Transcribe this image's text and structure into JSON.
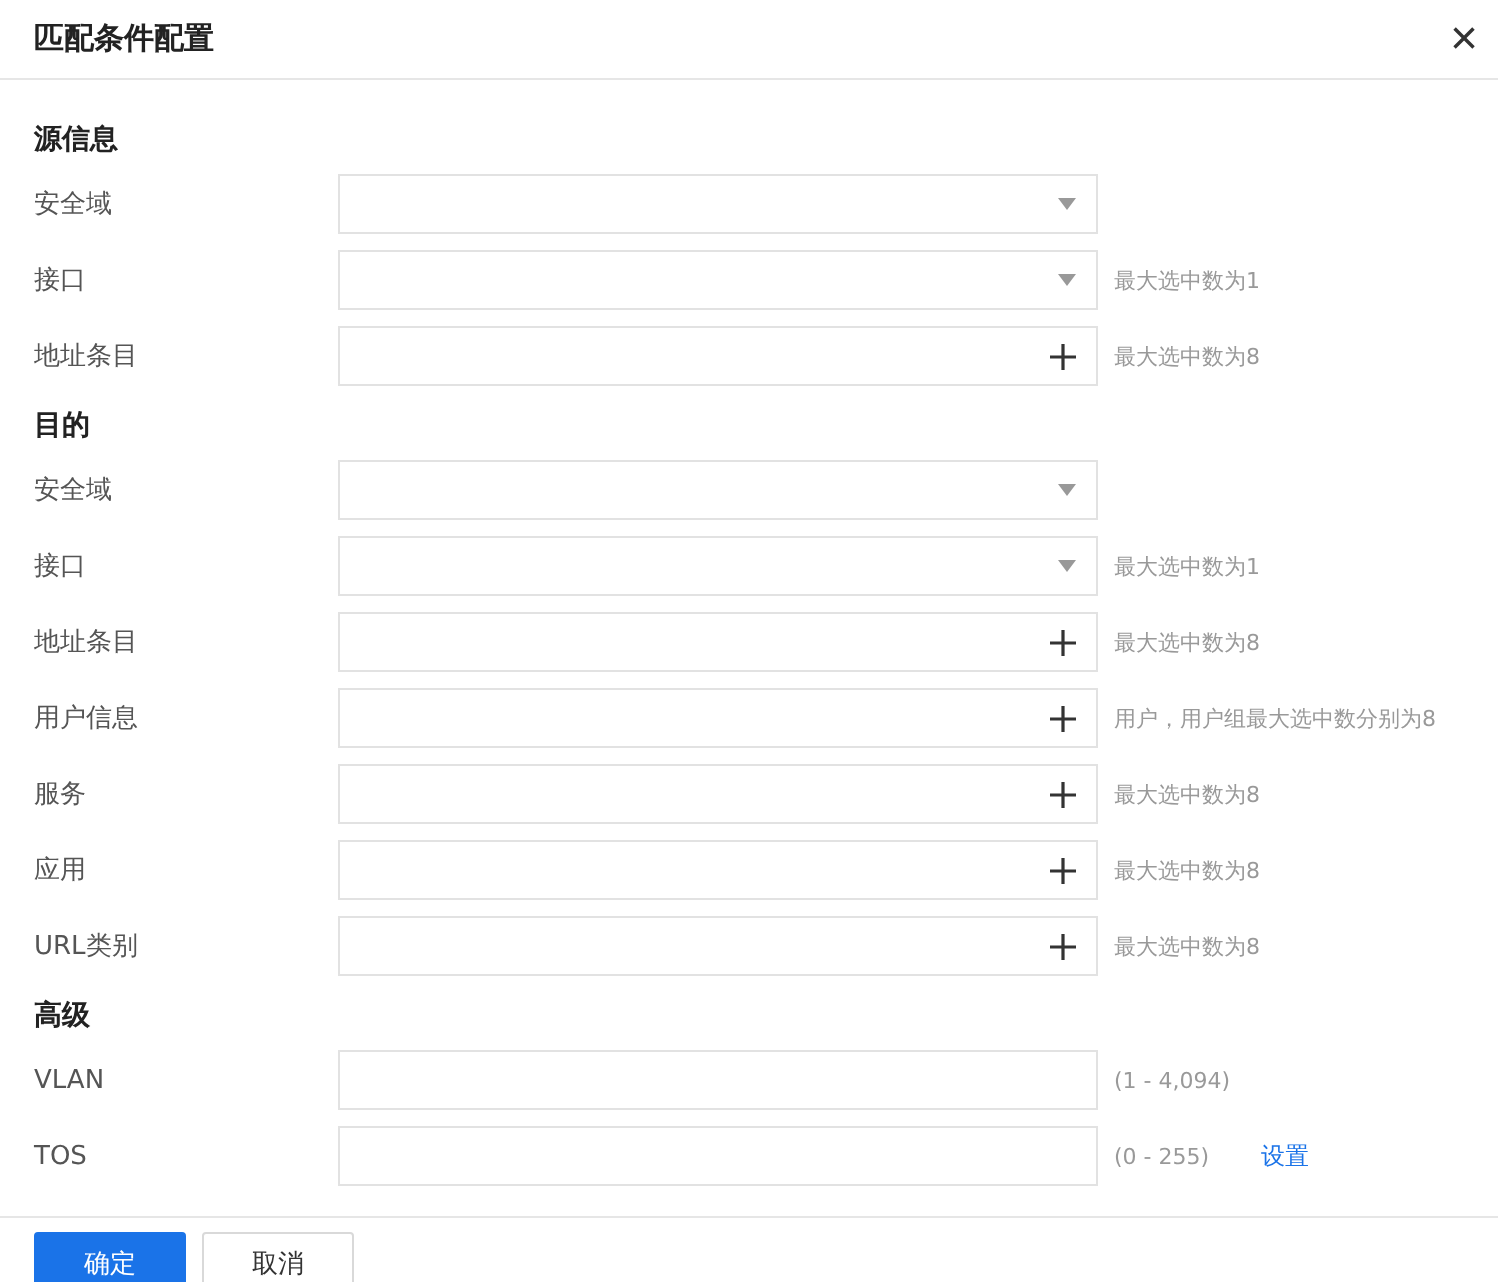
{
  "dialog": {
    "title": "匹配条件配置",
    "close_icon": "×"
  },
  "sections": [
    {
      "heading": "源信息",
      "rows": [
        {
          "label": "安全域",
          "kind": "select"
        },
        {
          "label": "接口",
          "kind": "select",
          "note": "最大选中数为1"
        },
        {
          "label": "地址条目",
          "kind": "picker",
          "note": "最大选中数为8"
        }
      ]
    },
    {
      "heading": "目的",
      "rows": [
        {
          "label": "安全域",
          "kind": "select"
        },
        {
          "label": "接口",
          "kind": "select",
          "note": "最大选中数为1"
        },
        {
          "label": "地址条目",
          "kind": "picker",
          "note": "最大选中数为8"
        },
        {
          "label": "用户信息",
          "kind": "picker",
          "note": "用户，用户组最大选中数分别为8"
        },
        {
          "label": "服务",
          "kind": "picker",
          "note": "最大选中数为8"
        },
        {
          "label": "应用",
          "kind": "picker",
          "note": "最大选中数为8"
        },
        {
          "label": "URL类别",
          "kind": "picker",
          "note": "最大选中数为8"
        }
      ]
    },
    {
      "heading": "高级",
      "rows": [
        {
          "label": "VLAN",
          "kind": "text",
          "note": "(1 - 4,094)"
        },
        {
          "label": "TOS",
          "kind": "text",
          "note": "(0 - 255)",
          "link": "设置"
        }
      ]
    }
  ],
  "buttons": [
    {
      "label": "确定",
      "primary": true
    },
    {
      "label": "取消",
      "primary": false
    }
  ]
}
